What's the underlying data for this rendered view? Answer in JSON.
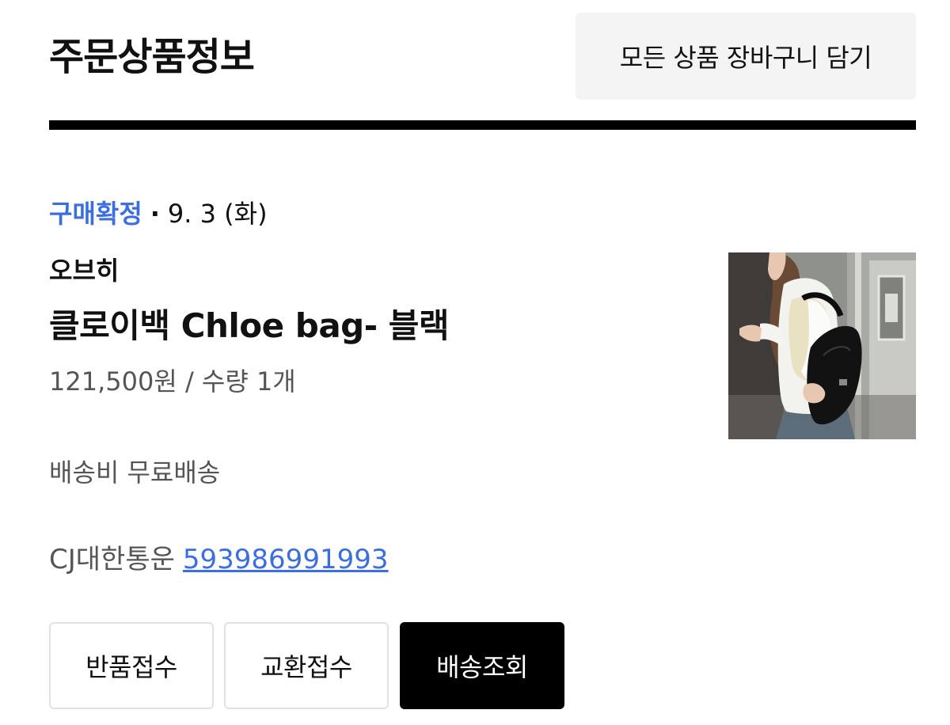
{
  "header": {
    "title": "주문상품정보",
    "cart_all_label": "모든 상품 장바구니 담기"
  },
  "order": {
    "status": "구매확정",
    "separator": "·",
    "date": "9. 3 (화)",
    "seller": "오브히",
    "product_name": "클로이백 Chloe bag- 블랙",
    "price_qty": "121,500원 / 수량 1개",
    "shipping_fee": "배송비 무료배송",
    "carrier": "CJ대한통운",
    "tracking_number": "593986991993"
  },
  "actions": {
    "return_label": "반품접수",
    "exchange_label": "교환접수",
    "track_label": "배송조회"
  },
  "colors": {
    "accent": "#3b6fe0",
    "text": "#111111",
    "muted": "#555555",
    "button_bg": "#f4f4f4",
    "primary_button": "#000000"
  }
}
